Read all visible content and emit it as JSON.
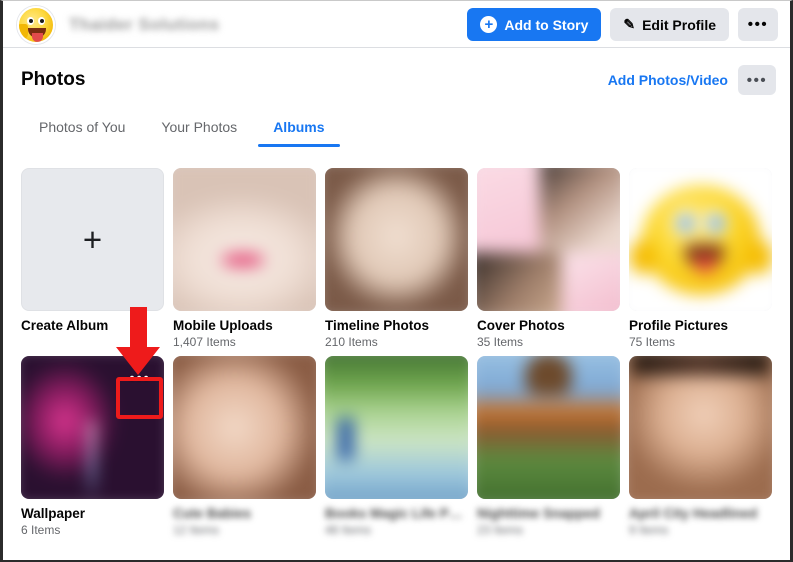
{
  "topbar": {
    "avatar_icon": "smiley-emoji-avatar",
    "profile_name": "Thaider Solutions",
    "add_to_story_label": "Add to Story",
    "add_to_story_icon": "plus-circle-icon",
    "edit_profile_label": "Edit Profile",
    "edit_profile_icon": "pencil-icon",
    "more_label": "•••",
    "more_icon": "ellipsis-icon",
    "primary_color": "#1877f2",
    "secondary_color": "#e4e6eb"
  },
  "photos_card": {
    "title": "Photos",
    "add_photos_link": "Add Photos/Video",
    "more_icon": "ellipsis-icon",
    "more_label": "•••",
    "tabs": [
      {
        "label": "Photos of You",
        "active": false
      },
      {
        "label": "Your Photos",
        "active": false
      },
      {
        "label": "Albums",
        "active": true
      }
    ],
    "active_tab_color": "#1877f2"
  },
  "albums": [
    {
      "name": "Create Album",
      "count": "",
      "type": "create",
      "icon": "plus-icon",
      "thumb_class": "create",
      "blurred_label": false
    },
    {
      "name": "Mobile Uploads",
      "count": "1,407 Items",
      "type": "album",
      "thumb_class": "img-mobile",
      "blurred_label": false
    },
    {
      "name": "Timeline Photos",
      "count": "210 Items",
      "type": "album",
      "thumb_class": "img-timeline",
      "blurred_label": false
    },
    {
      "name": "Cover Photos",
      "count": "35 Items",
      "type": "album",
      "thumb_class": "img-cover",
      "blurred_label": false
    },
    {
      "name": "Profile Pictures",
      "count": "75 Items",
      "type": "album",
      "thumb_class": "img-profile",
      "blurred_label": false
    },
    {
      "name": "Wallpaper",
      "count": "6 Items",
      "type": "album",
      "thumb_class": "img-wallpaper",
      "blurred_label": false,
      "menu_open": true,
      "menu_icon": "ellipsis-icon",
      "menu_label": "•••"
    },
    {
      "name": "Cute Babies",
      "count": "12 Items",
      "type": "album",
      "thumb_class": "img-baby",
      "blurred_label": true
    },
    {
      "name": "Books Magic Life Photos",
      "count": "48 Items",
      "type": "album",
      "thumb_class": "img-green",
      "blurred_label": true
    },
    {
      "name": "Nighttime Snapped",
      "count": "23 Items",
      "type": "album",
      "thumb_class": "img-sky",
      "blurred_label": true
    },
    {
      "name": "April City Headlined",
      "count": "9 Items",
      "type": "album",
      "thumb_class": "img-portrait",
      "blurred_label": true
    }
  ],
  "annotation": {
    "highlight_color": "#ee1b1b",
    "arrow_target": "album-menu-button-wallpaper",
    "highlight_target": "album-menu-button-wallpaper"
  }
}
